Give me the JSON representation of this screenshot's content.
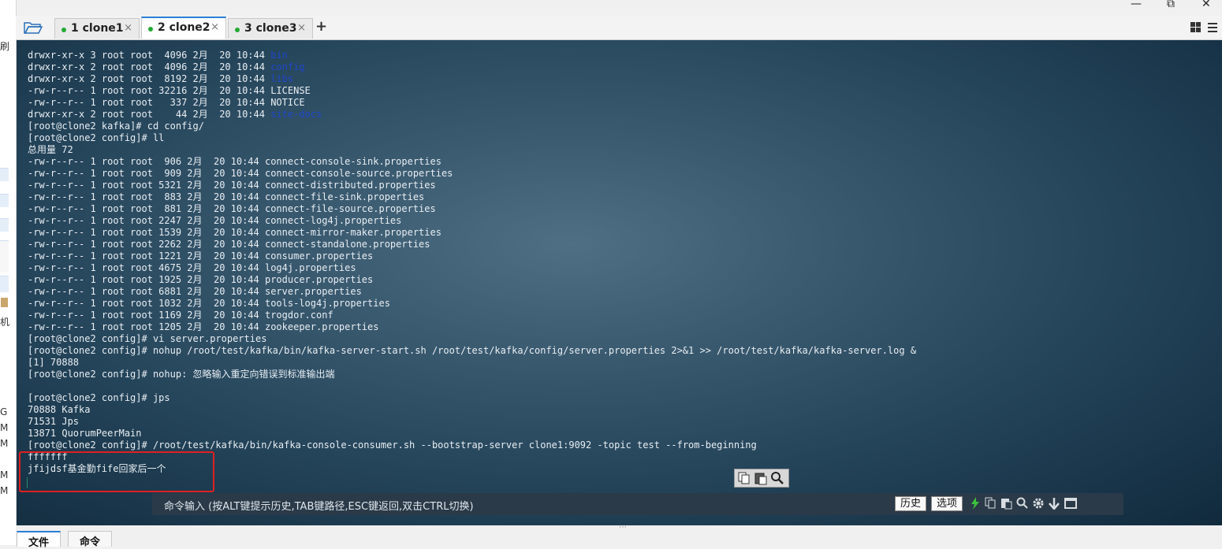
{
  "window": {
    "minimize": "—",
    "restore": "⧉",
    "close": "✕"
  },
  "left_strip": {
    "texts": [
      "刷",
      "机",
      "G",
      "M",
      "M",
      "M",
      "M"
    ]
  },
  "tabs": [
    {
      "label": "1 clone1",
      "close": "×",
      "status_color": "#22aa33"
    },
    {
      "label": "2 clone2",
      "close": "×",
      "status_color": "#22aa33"
    },
    {
      "label": "3 clone3",
      "close": "×",
      "status_color": "#22aa33"
    }
  ],
  "tab_add": "+",
  "terminal": {
    "lines": [
      [
        {
          "t": "drwxr-xr-x 3 root root  4096 2月  20 10:44 "
        },
        {
          "t": "bin",
          "c": "dir"
        }
      ],
      [
        {
          "t": "drwxr-xr-x 2 root root  4096 2月  20 10:44 "
        },
        {
          "t": "config",
          "c": "dir"
        }
      ],
      [
        {
          "t": "drwxr-xr-x 2 root root  8192 2月  20 10:44 "
        },
        {
          "t": "libs",
          "c": "dir"
        }
      ],
      [
        {
          "t": "-rw-r--r-- 1 root root 32216 2月  20 10:44 LICENSE"
        }
      ],
      [
        {
          "t": "-rw-r--r-- 1 root root   337 2月  20 10:44 NOTICE"
        }
      ],
      [
        {
          "t": "drwxr-xr-x 2 root root    44 2月  20 10:44 "
        },
        {
          "t": "site-docs",
          "c": "dir"
        }
      ],
      [
        {
          "t": "[root@clone2 kafka]# cd config/"
        }
      ],
      [
        {
          "t": "[root@clone2 config]# ll"
        }
      ],
      [
        {
          "t": "总用量 72"
        }
      ],
      [
        {
          "t": "-rw-r--r-- 1 root root  906 2月  20 10:44 connect-console-sink.properties"
        }
      ],
      [
        {
          "t": "-rw-r--r-- 1 root root  909 2月  20 10:44 connect-console-source.properties"
        }
      ],
      [
        {
          "t": "-rw-r--r-- 1 root root 5321 2月  20 10:44 connect-distributed.properties"
        }
      ],
      [
        {
          "t": "-rw-r--r-- 1 root root  883 2月  20 10:44 connect-file-sink.properties"
        }
      ],
      [
        {
          "t": "-rw-r--r-- 1 root root  881 2月  20 10:44 connect-file-source.properties"
        }
      ],
      [
        {
          "t": "-rw-r--r-- 1 root root 2247 2月  20 10:44 connect-log4j.properties"
        }
      ],
      [
        {
          "t": "-rw-r--r-- 1 root root 1539 2月  20 10:44 connect-mirror-maker.properties"
        }
      ],
      [
        {
          "t": "-rw-r--r-- 1 root root 2262 2月  20 10:44 connect-standalone.properties"
        }
      ],
      [
        {
          "t": "-rw-r--r-- 1 root root 1221 2月  20 10:44 consumer.properties"
        }
      ],
      [
        {
          "t": "-rw-r--r-- 1 root root 4675 2月  20 10:44 log4j.properties"
        }
      ],
      [
        {
          "t": "-rw-r--r-- 1 root root 1925 2月  20 10:44 producer.properties"
        }
      ],
      [
        {
          "t": "-rw-r--r-- 1 root root 6881 2月  20 10:44 server.properties"
        }
      ],
      [
        {
          "t": "-rw-r--r-- 1 root root 1032 2月  20 10:44 tools-log4j.properties"
        }
      ],
      [
        {
          "t": "-rw-r--r-- 1 root root 1169 2月  20 10:44 trogdor.conf"
        }
      ],
      [
        {
          "t": "-rw-r--r-- 1 root root 1205 2月  20 10:44 zookeeper.properties"
        }
      ],
      [
        {
          "t": "[root@clone2 config]# vi server.properties"
        }
      ],
      [
        {
          "t": "[root@clone2 config]# nohup /root/test/kafka/bin/kafka-server-start.sh /root/test/kafka/config/server.properties 2>&1 >> /root/test/kafka/kafka-server.log &"
        }
      ],
      [
        {
          "t": "[1] 70888"
        }
      ],
      [
        {
          "t": "[root@clone2 config]# nohup: 忽略输入重定向错误到标准输出端"
        }
      ],
      [
        {
          "t": ""
        }
      ],
      [
        {
          "t": "[root@clone2 config]# jps"
        }
      ],
      [
        {
          "t": "70888 Kafka"
        }
      ],
      [
        {
          "t": "71531 Jps"
        }
      ],
      [
        {
          "t": "13871 QuorumPeerMain"
        }
      ],
      [
        {
          "t": "[root@clone2 config]# /root/test/kafka/bin/kafka-console-consumer.sh --bootstrap-server clone1:9092 -topic test --from-beginning"
        }
      ],
      [
        {
          "t": "fffffff"
        }
      ],
      [
        {
          "t": "jfijdsf基金勤fife回家后一个"
        }
      ]
    ],
    "dir_color": "#1f47c9"
  },
  "command_bar": {
    "hint": "命令输入 (按ALT键提示历史,TAB键路径,ESC键返回,双击CTRL切换)",
    "history_label": "历史",
    "options_label": "选项"
  },
  "bottom_tabs": [
    {
      "label": "文件"
    },
    {
      "label": "命令"
    }
  ],
  "resize_handle": "⋯"
}
